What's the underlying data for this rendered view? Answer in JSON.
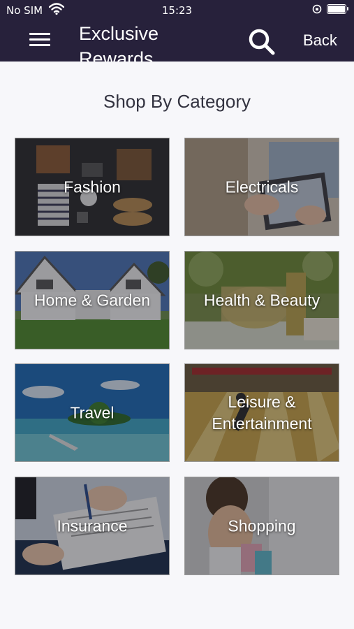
{
  "status_bar": {
    "carrier": "No SIM",
    "time": "15:23"
  },
  "nav": {
    "title": "Exclusive Rewards",
    "back_label": "Back",
    "bg_color": "#27213b"
  },
  "page": {
    "section_title": "Shop By Category"
  },
  "categories": [
    {
      "label": "Fashion",
      "image": "flat-lay-clothing-photo"
    },
    {
      "label": "Electricals",
      "image": "hands-on-laptop-photo"
    },
    {
      "label": "Home & Garden",
      "image": "house-and-lawn-photo"
    },
    {
      "label": "Health & Beauty",
      "image": "cosmetic-jar-photo"
    },
    {
      "label": "Travel",
      "image": "tropical-island-photo"
    },
    {
      "label": "Leisure & Entertainment",
      "image": "bowling-alley-photo"
    },
    {
      "label": "Insurance",
      "image": "signing-document-photo"
    },
    {
      "label": "Shopping",
      "image": "woman-with-shopping-bags-photo"
    }
  ]
}
